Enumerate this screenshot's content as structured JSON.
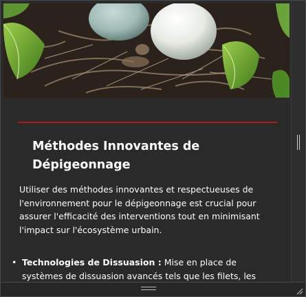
{
  "hero": {
    "image": "nest-with-eggs-photo"
  },
  "article": {
    "title": "Méthodes Innovantes de Dépigeonnage",
    "intro": "Utiliser des méthodes innovantes et respectueuses de l'environnement pour le dépigeonnage est crucial pour assurer l'efficacité des interventions tout en minimisant l'impact sur l'écosystème urbain.",
    "list": [
      {
        "term": "Technologies de Dissuasion :",
        "text": " Mise en place de systèmes de dissuasion avancés tels que les filets, les picots et les"
      }
    ]
  },
  "colors": {
    "accent_rule": "#b11a1a",
    "background": "#2a2a2a",
    "text": "#ffffff"
  },
  "icons": {
    "scroll_thumb": "scroll-thumb-icon",
    "drag_handle": "drag-handle-icon",
    "resize": "resize-grip-icon"
  }
}
